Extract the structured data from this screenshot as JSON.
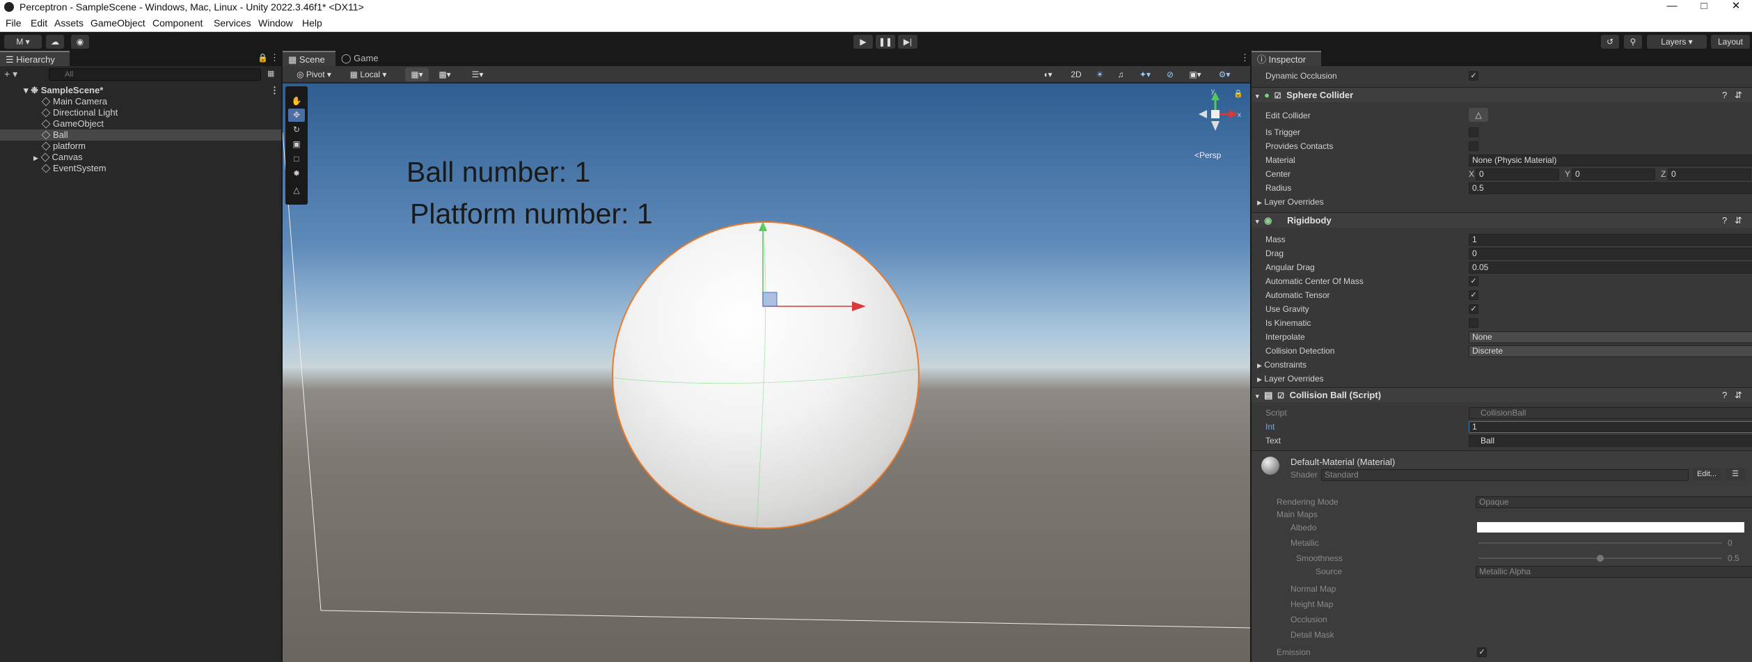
{
  "window": {
    "title": "Perceptron - SampleScene - Windows, Mac, Linux - Unity 2022.3.46f1* <DX11>"
  },
  "menu": [
    "File",
    "Edit",
    "Assets",
    "GameObject",
    "Component",
    "Services",
    "Window",
    "Help"
  ],
  "toolbar": {
    "account": "M",
    "layers": "Layers",
    "layout": "Layout"
  },
  "hierarchy": {
    "tab": "Hierarchy",
    "search_placeholder": "All",
    "scene": "SampleScene*",
    "items": [
      "Main Camera",
      "Directional Light",
      "GameObject",
      "Ball",
      "platform",
      "Canvas",
      "EventSystem"
    ],
    "selected": "Ball"
  },
  "scene": {
    "tabs": [
      "Scene",
      "Game"
    ],
    "pivot": "Pivot",
    "local": "Local",
    "mode2d": "2D",
    "persp": "<Persp",
    "text1": "Ball number: 1",
    "text2": "Platform number: 1",
    "gizmo_x": "x",
    "gizmo_y": "y"
  },
  "inspector": {
    "tab": "Inspector",
    "dynamic_occlusion": "Dynamic Occlusion",
    "sphere_collider": {
      "title": "Sphere Collider",
      "edit_collider": "Edit Collider",
      "is_trigger": "Is Trigger",
      "provides_contacts": "Provides Contacts",
      "material_label": "Material",
      "material_value": "None (Physic Material)",
      "center_label": "Center",
      "center": {
        "x_label": "X",
        "x": "0",
        "y_label": "Y",
        "y": "0",
        "z_label": "Z",
        "z": "0"
      },
      "radius_label": "Radius",
      "radius": "0.5",
      "layer_overrides": "Layer Overrides"
    },
    "rigidbody": {
      "title": "Rigidbody",
      "mass_label": "Mass",
      "mass": "1",
      "drag_label": "Drag",
      "drag": "0",
      "angular_drag_label": "Angular Drag",
      "angular_drag": "0.05",
      "auto_com": "Automatic Center Of Mass",
      "auto_tensor": "Automatic Tensor",
      "use_gravity": "Use Gravity",
      "is_kinematic": "Is Kinematic",
      "interpolate_label": "Interpolate",
      "interpolate": "None",
      "collision_label": "Collision Detection",
      "collision": "Discrete",
      "constraints": "Constraints",
      "layer_overrides": "Layer Overrides"
    },
    "script": {
      "title": "Collision Ball (Script)",
      "script_label": "Script",
      "script_value": "CollisionBall",
      "int_label": "Int",
      "int_value": "1",
      "text_label": "Text",
      "text_value": "Ball"
    },
    "material": {
      "title": "Default-Material (Material)",
      "shader_label": "Shader",
      "shader": "Standard",
      "edit": "Edit...",
      "rendering_mode_label": "Rendering Mode",
      "rendering_mode": "Opaque",
      "main_maps": "Main Maps",
      "albedo": "Albedo",
      "metallic": "Metallic",
      "metallic_value": "0",
      "smoothness": "Smoothness",
      "smoothness_value": "0.5",
      "source_label": "Source",
      "source": "Metallic Alpha",
      "normal_map": "Normal Map",
      "height_map": "Height Map",
      "occlusion": "Occlusion",
      "detail_mask": "Detail Mask",
      "emission": "Emission"
    }
  },
  "colors": {
    "accent": "#3a79bb",
    "selection_outline": "#e87a2a",
    "panel": "#383838"
  }
}
